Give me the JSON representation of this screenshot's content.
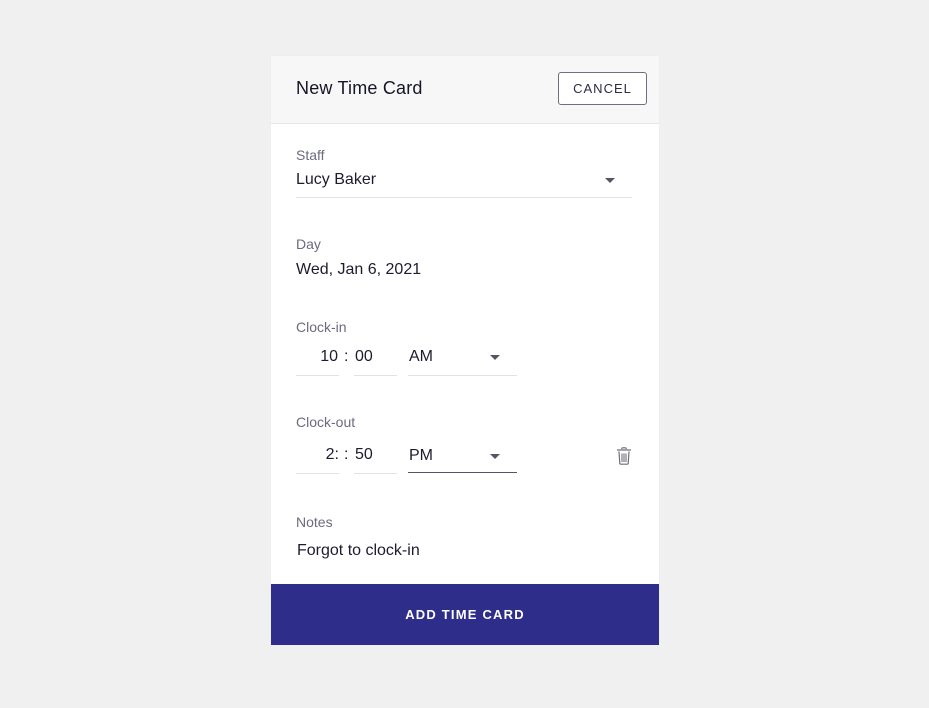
{
  "header": {
    "title": "New Time Card",
    "cancel_label": "CANCEL"
  },
  "staff": {
    "label": "Staff",
    "value": "Lucy Baker"
  },
  "day": {
    "label": "Day",
    "value": "Wed, Jan 6, 2021"
  },
  "clock_in": {
    "label": "Clock-in",
    "hour": "10",
    "separator": ":",
    "minute": "00",
    "period": "AM"
  },
  "clock_out": {
    "label": "Clock-out",
    "hour": "2:",
    "separator": ":",
    "minute": "50",
    "period": "PM"
  },
  "notes": {
    "label": "Notes",
    "value": "Forgot to clock-in"
  },
  "submit_label": "ADD TIME CARD",
  "colors": {
    "background": "#f0f0f0",
    "header_bg": "#f7f7f7",
    "primary_button": "#2e2d89",
    "label_text": "#6b6b80"
  },
  "icons": {
    "dropdown": "caret-down-icon",
    "delete": "trash-icon"
  }
}
